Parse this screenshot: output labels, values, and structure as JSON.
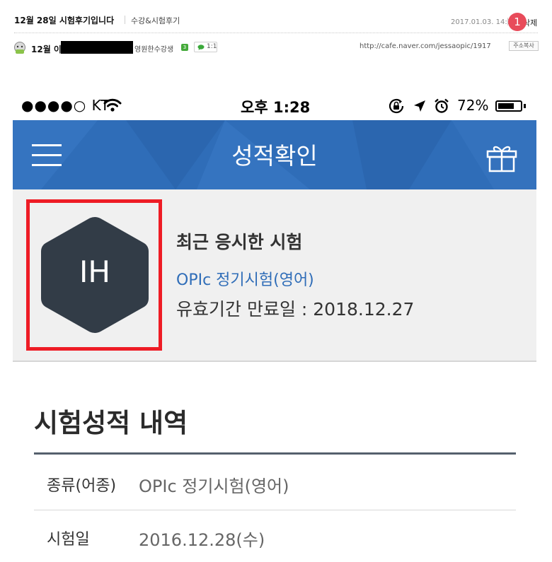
{
  "post": {
    "title": "12월 28일 시험후기입니다",
    "category": "수강&시험후기",
    "date": "2017.01.03. 14:10",
    "delete_label": "삭제",
    "author_prefix": "12월 이",
    "author_grade": "영원한수강생",
    "grade_badge": "3",
    "chat_label": "1:1",
    "url": "http://cafe.naver.com/jessaopic/1917",
    "copy_label": "주소복사"
  },
  "phone": {
    "status": {
      "carrier": "●●●●○ KT",
      "time": "오후 1:28",
      "battery": "72%",
      "battery_level": 0.72
    },
    "header": {
      "title": "성적확인",
      "gift_badge": "1",
      "colors": {
        "background": "#2f6db8"
      }
    },
    "summary": {
      "grade": "IH",
      "recent_title": "최근 응시한 시험",
      "recent_test": "OPIc 정기시험(영어)",
      "expiry": "유효기간 만료일 : 2018.12.27",
      "colors": {
        "hex": "#323c47",
        "highlight_box": "#ee1c25",
        "link": "#2f6db8"
      }
    },
    "history": {
      "title": "시험성적 내역",
      "rows": [
        {
          "label": "종류(어종)",
          "value": "OPIc 정기시험(영어)"
        },
        {
          "label": "시험일",
          "value": "2016.12.28(수)"
        }
      ]
    }
  }
}
